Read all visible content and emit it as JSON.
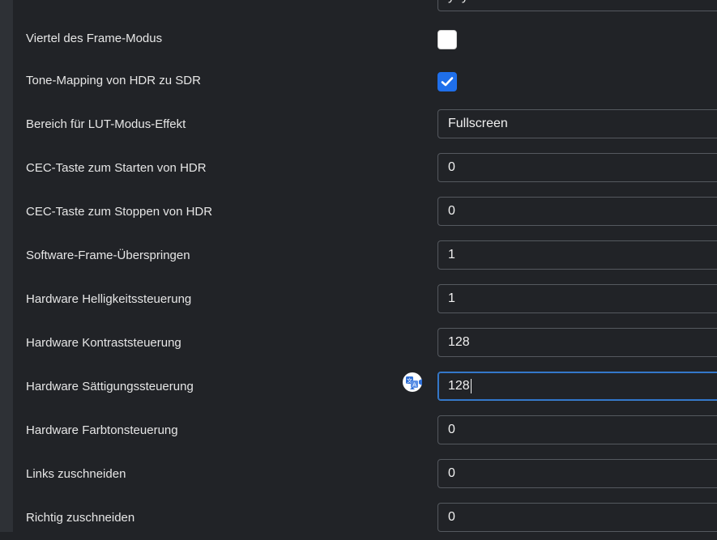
{
  "top_field": {
    "value": "yuyv"
  },
  "rows": [
    {
      "label": "Viertel des Frame-Modus",
      "type": "checkbox",
      "checked": false
    },
    {
      "label": "Tone-Mapping von HDR zu SDR",
      "type": "checkbox",
      "checked": true
    },
    {
      "label": "Bereich für LUT-Modus-Effekt",
      "type": "select",
      "value": "Fullscreen"
    },
    {
      "label": "CEC-Taste zum Starten von HDR",
      "type": "number",
      "value": "0"
    },
    {
      "label": "CEC-Taste zum Stoppen von HDR",
      "type": "number",
      "value": "0"
    },
    {
      "label": "Software-Frame-Überspringen",
      "type": "number",
      "value": "1"
    },
    {
      "label": "Hardware Helligkeitssteuerung",
      "type": "number",
      "value": "1"
    },
    {
      "label": "Hardware Kontraststeuerung",
      "type": "number",
      "value": "128"
    },
    {
      "label": "Hardware Sättigungssteuerung",
      "type": "number",
      "value": "128"
    },
    {
      "label": "Hardware Farbtonsteuerung",
      "type": "number",
      "value": "0"
    },
    {
      "label": "Links zuschneiden",
      "type": "number",
      "value": "0"
    },
    {
      "label": "Richtig zuschneiden",
      "type": "number",
      "value": "0"
    }
  ],
  "colors": {
    "background": "#212327",
    "accent": "#1f6feb",
    "focus_border": "#3b82d6"
  },
  "icons": {
    "translate": "translate-icon",
    "checkmark": "checkmark-icon"
  }
}
